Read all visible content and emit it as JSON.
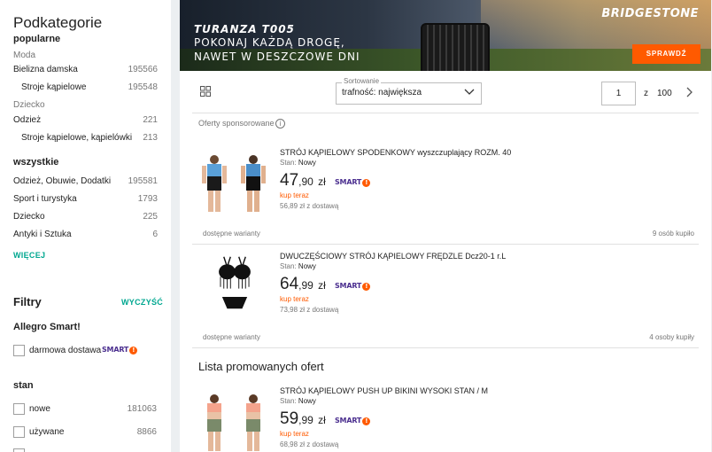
{
  "sidebar": {
    "title": "Podkategorie",
    "popular_label": "popularne",
    "popular_sections": [
      {
        "name": "Moda",
        "items": [
          {
            "label": "Bielizna damska",
            "count": "195566",
            "indent": false
          },
          {
            "label": "Stroje kąpielowe",
            "count": "195548",
            "indent": true
          }
        ]
      },
      {
        "name": "Dziecko",
        "items": [
          {
            "label": "Odzież",
            "count": "221",
            "indent": false
          },
          {
            "label": "Stroje kąpielowe, kąpielówki",
            "count": "213",
            "indent": true
          }
        ]
      }
    ],
    "all_label": "wszystkie",
    "all_items": [
      {
        "label": "Odzież, Obuwie, Dodatki",
        "count": "195581"
      },
      {
        "label": "Sport i turystyka",
        "count": "1793"
      },
      {
        "label": "Dziecko",
        "count": "225"
      },
      {
        "label": "Antyki i Sztuka",
        "count": "6"
      }
    ],
    "more_label": "WIĘCEJ",
    "filters_title": "Filtry",
    "clear_label": "WYCZYŚĆ",
    "smart_title": "Allegro Smart!",
    "free_shipping_label": "darmowa dostawa",
    "smart_badge": "SMART",
    "stan_title": "stan",
    "stan_options": [
      {
        "label": "nowe",
        "count": "181063"
      },
      {
        "label": "używane",
        "count": "8866"
      }
    ]
  },
  "banner": {
    "product": "TURANZA T005",
    "line1": "POKONAJ KAŻDĄ DROGĘ,",
    "line2": "NAWET W DESZCZOWE DNI",
    "brand": "BRIDGESTONE",
    "cta": "SPRAWDŹ"
  },
  "toolbar": {
    "sort_label": "Sortowanie",
    "sort_value": "trafność: największa",
    "page_current": "1",
    "page_of": "z",
    "page_total": "100"
  },
  "sponsored_label": "Oferty sponsorowane",
  "offers": [
    {
      "title": "STRÓJ KĄPIELOWY SPODENKOWY wyszczuplający ROZM. 40",
      "stan_label": "Stan:",
      "stan_value": "Nowy",
      "price_int": "47",
      "price_dec": ",90",
      "currency": "zł",
      "smart": "SMART",
      "buy_now": "kup teraz",
      "shipping": "56,89 zł z dostawą",
      "variants": "dostępne warianty",
      "bought": "9 osób kupiło"
    },
    {
      "title": "DWUCZĘŚCIOWY STRÓJ KĄPIELOWY FRĘDZLE Dcz20-1 r.L",
      "stan_label": "Stan:",
      "stan_value": "Nowy",
      "price_int": "64",
      "price_dec": ",99",
      "currency": "zł",
      "smart": "SMART",
      "buy_now": "kup teraz",
      "shipping": "73,98 zł z dostawą",
      "variants": "dostępne warianty",
      "bought": "4 osoby kupiły"
    }
  ],
  "promo_heading": "Lista promowanych ofert",
  "promo_offer": {
    "title": "STRÓJ KĄPIELOWY PUSH UP BIKINI WYSOKI STAN / M",
    "stan_label": "Stan:",
    "stan_value": "Nowy",
    "price_int": "59",
    "price_dec": ",99",
    "currency": "zł",
    "smart": "SMART",
    "buy_now": "kup teraz",
    "shipping": "68,98 zł z dostawą"
  },
  "colors": {
    "accent": "#00a790",
    "orange": "#ff5a00",
    "smart_purple": "#4b2f8f"
  }
}
